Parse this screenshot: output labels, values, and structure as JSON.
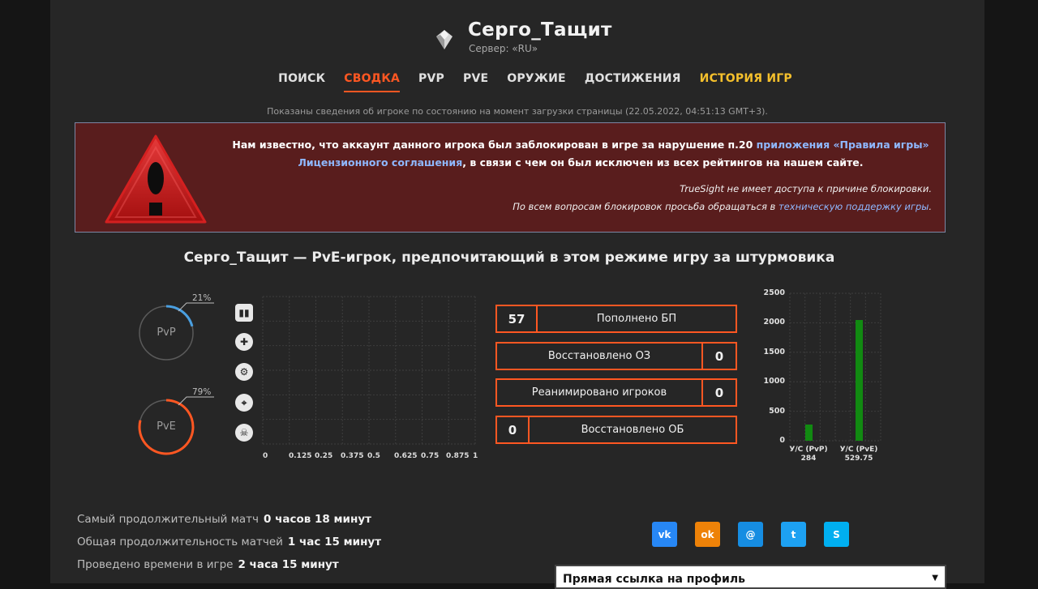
{
  "header": {
    "player_name": "Серго_Тащит",
    "server": "Сервер: «RU»"
  },
  "nav": {
    "items": [
      {
        "label": "ПОИСК"
      },
      {
        "label": "СВОДКА",
        "active": true
      },
      {
        "label": "PVP"
      },
      {
        "label": "PVE"
      },
      {
        "label": "ОРУЖИЕ"
      },
      {
        "label": "ДОСТИЖЕНИЯ"
      },
      {
        "label": "ИСТОРИЯ ИГР"
      }
    ]
  },
  "info_line": "Показаны сведения об игроке по состоянию на момент загрузки страницы (22.05.2022, 04:51:13 GMT+3).",
  "ban": {
    "text_part1": "Нам известно, что аккаунт данного игрока был заблокирован в игре за нарушение п.20 ",
    "link1": "приложения «Правила игры»",
    "link2": "Лицензионного соглашения",
    "text_part2": ", в связи с чем он был исключен из всех рейтингов на нашем сайте.",
    "note1": "TrueSight не имеет доступа к причине блокировки.",
    "note2_prefix": "По всем вопросам блокировок просьба обращаться в ",
    "note2_link": "техническую поддержку игры",
    "note2_suffix": "."
  },
  "headline": "Серго_Тащит — PvE-игрок, предпочитающий в этом режиме игру за штурмовика",
  "modes": {
    "pvp": {
      "label": "PvP",
      "percent_text": "21%",
      "share": 0.21,
      "color": "#4a9fe0"
    },
    "pve": {
      "label": "PvE",
      "percent_text": "79%",
      "share": 0.79,
      "color": "#ff5722"
    }
  },
  "class_matrix": {
    "ticks": [
      "0",
      "0.125",
      "0.25",
      "0.375",
      "0.5",
      "0.625",
      "0.75",
      "0.875",
      "1"
    ],
    "icons": [
      "rifleman-icon",
      "medic-icon",
      "engineer-icon",
      "sniper-icon",
      "sed-icon"
    ]
  },
  "stats": [
    {
      "value": "57",
      "label": "Пополнено БП",
      "side": "left"
    },
    {
      "value": "0",
      "label": "Восстановлено ОЗ",
      "side": "right"
    },
    {
      "value": "0",
      "label": "Реанимировано игроков",
      "side": "right"
    },
    {
      "value": "0",
      "label": "Восстановлено ОБ",
      "side": "left"
    }
  ],
  "chart_data": {
    "type": "bar",
    "categories": [
      "У/С (PvP)",
      "У/С (PvE)"
    ],
    "values": [
      284,
      529.75
    ],
    "value_labels": [
      "284",
      "529.75"
    ],
    "plotted_heights": [
      270,
      2050
    ],
    "yticks": [
      "0",
      "500",
      "1000",
      "1500",
      "2000",
      "2500"
    ],
    "ylim": [
      0,
      2500
    ],
    "grid": true,
    "bar_color": "#118a11"
  },
  "bottom_stats": [
    {
      "label": "Самый продолжительный матч",
      "value": "0 часов 18 минут"
    },
    {
      "label": "Общая продолжительность матчей",
      "value": "1 час 15 минут"
    },
    {
      "label": "Проведено времени в игре",
      "value": "2 часа 15 минут"
    }
  ],
  "social": [
    {
      "name": "vk-icon",
      "glyph": "vk",
      "color": "#2787f5"
    },
    {
      "name": "odnoklassniki-icon",
      "glyph": "ok",
      "color": "#ee8208"
    },
    {
      "name": "moimir-icon",
      "glyph": "@",
      "color": "#168de2"
    },
    {
      "name": "twitter-icon",
      "glyph": "t",
      "color": "#1da1f2"
    },
    {
      "name": "skype-icon",
      "glyph": "S",
      "color": "#00aff0"
    }
  ],
  "profile_select": {
    "value": "Прямая ссылка на профиль"
  }
}
